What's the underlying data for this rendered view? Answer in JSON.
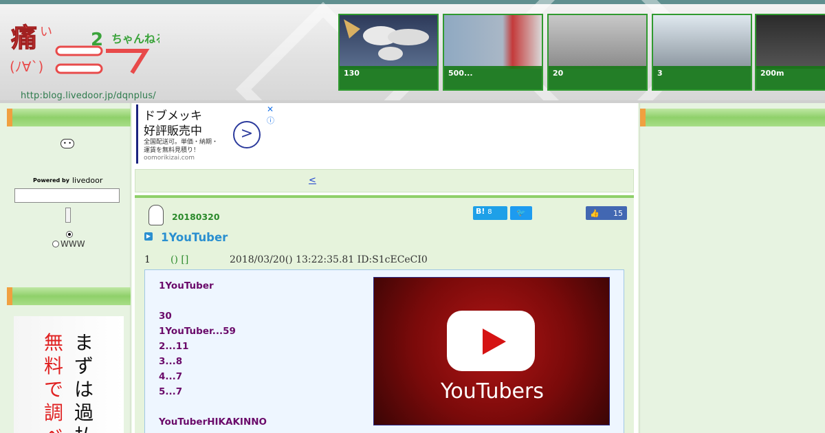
{
  "header": {
    "logo_text": "痛いニュース(ノ∀`)",
    "logo_url": "http:blog.livedoor.jp/dqnplus/",
    "thumbnails": [
      {
        "label": "130",
        "icon": "world-map-image"
      },
      {
        "label": "500...",
        "icon": "building-image"
      },
      {
        "label": "20",
        "icon": "police-station-image"
      },
      {
        "label": "3",
        "icon": "tower-image"
      },
      {
        "label": "200m",
        "icon": "night-image"
      }
    ]
  },
  "sidebar": {
    "powered_by": "Powered by",
    "brand": "livedoor",
    "search_value": "",
    "radio_www": "WWW",
    "ad_text_red": "無料で調べ",
    "ad_text_black": "まずは過払"
  },
  "ad": {
    "headline1": "ドブメッキ",
    "headline2": "好評販売中",
    "line1": "全国配送可。単価・納期・",
    "line2": "運賃を無料見積り！",
    "domain": "oomorikizai.com"
  },
  "nav": {
    "prev_link": "<"
  },
  "post": {
    "date": "20180320",
    "title": "1YouTuber",
    "hatena_count": "8",
    "like_count": "15",
    "res_number": "1",
    "res_name": "() []",
    "res_meta": "2018/03/20() 13:22:35.81 ID:S1cECeCI0",
    "body_lines": [
      "1YouTuber",
      "",
      "30",
      "1YouTuber...59",
      "2...11",
      "3...8",
      "4...7",
      "5...7",
      "",
      "YouTuberHIKAKINNO"
    ],
    "image_caption": "YouTubers"
  },
  "colors": {
    "accent_green": "#8fd06a",
    "link_blue": "#1a3fcf",
    "title_blue": "#2a8fd0",
    "quote_purple": "#6a0a6a"
  }
}
